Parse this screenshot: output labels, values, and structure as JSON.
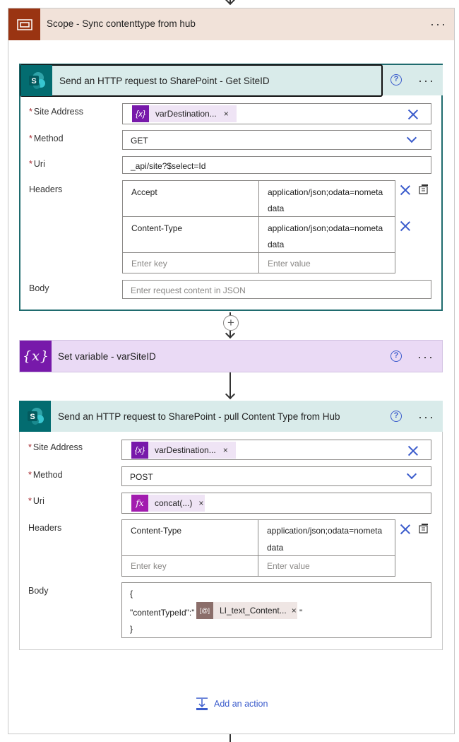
{
  "scope": {
    "title": "Scope - Sync contenttype from hub",
    "more": "···"
  },
  "action1": {
    "title": "Send an HTTP request to SharePoint - Get SiteID",
    "help": "?",
    "more": "···",
    "site_address_label": "Site Address",
    "site_address_token": "varDestination...",
    "method_label": "Method",
    "method_value": "GET",
    "uri_label": "Uri",
    "uri_value": "_api/site?$select=Id",
    "headers_label": "Headers",
    "headers": [
      {
        "key": "Accept",
        "value_line1": "application/json;odata=nometa",
        "value_line2": "data"
      },
      {
        "key": "Content-Type",
        "value_line1": "application/json;odata=nometa",
        "value_line2": "data"
      }
    ],
    "key_placeholder": "Enter key",
    "value_placeholder": "Enter value",
    "body_label": "Body",
    "body_placeholder": "Enter request content in JSON"
  },
  "action2": {
    "title": "Set variable - varSiteID",
    "help": "?",
    "more": "···"
  },
  "action3": {
    "title": "Send an HTTP request to SharePoint - pull Content Type from Hub",
    "help": "?",
    "more": "···",
    "site_address_label": "Site Address",
    "site_address_token": "varDestination...",
    "method_label": "Method",
    "method_value": "POST",
    "uri_label": "Uri",
    "uri_token": "concat(...)",
    "headers_label": "Headers",
    "headers": [
      {
        "key": "Content-Type",
        "value_line1": "application/json;odata=nometa",
        "value_line2": "data"
      }
    ],
    "key_placeholder": "Enter key",
    "value_placeholder": "Enter value",
    "body_label": "Body",
    "body_line1": "{",
    "body_line2_prefix": "\"contentTypeId\":\"",
    "body_token": "LI_text_Content...",
    "body_line2_suffix": "\"",
    "body_line3": "}"
  },
  "add_action": "Add an action",
  "required_mark": "*",
  "token_close": "×",
  "colors": {
    "scope_accent": "#9a3412",
    "sharepoint": "#036c70",
    "variable": "#7719aa",
    "link": "#3b5ccc"
  }
}
